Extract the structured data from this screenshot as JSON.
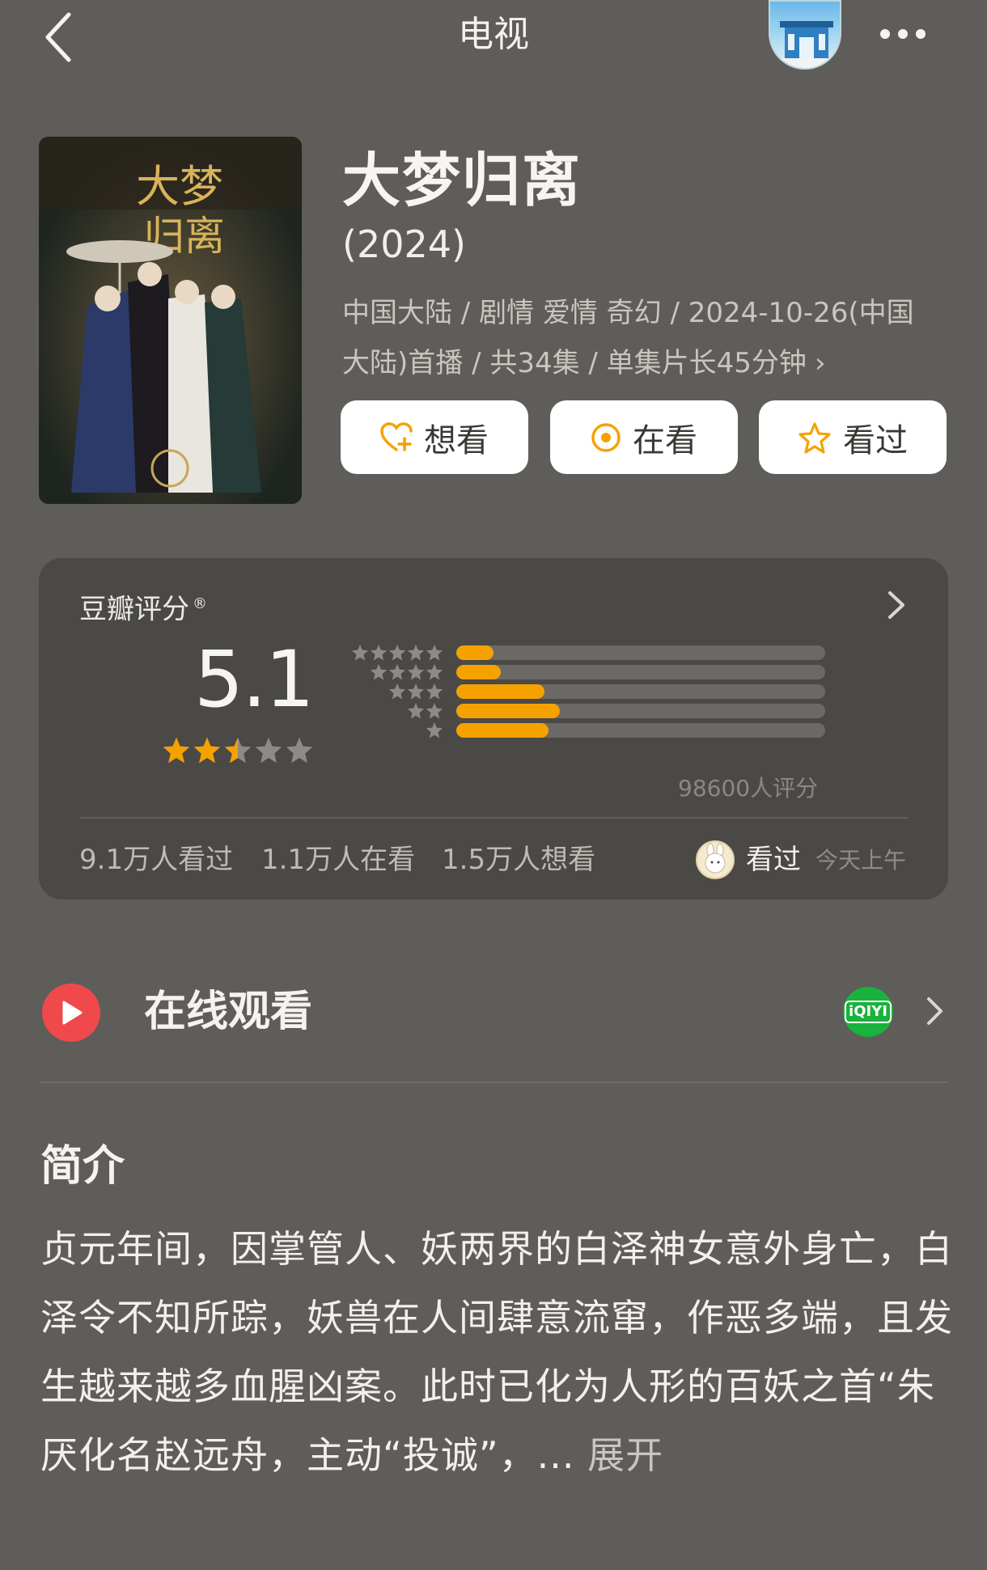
{
  "header": {
    "title": "电视"
  },
  "show": {
    "title": "大梦归离",
    "year": "(2024)",
    "meta_line1": "中国大陆 / 剧情 爱情 奇幻 / 2024-10-26(中国",
    "meta_line2": "大陆)首播 / 共34集 / 单集片长45分钟",
    "chevron": "›"
  },
  "actions": {
    "want_label": "想看",
    "watching_label": "在看",
    "watched_label": "看过"
  },
  "rating": {
    "label": "豆瓣评分",
    "registered": "®",
    "score": "5.1",
    "stars_value": 2.5,
    "distribution": [
      {
        "stars": 5,
        "fraction": 0.1
      },
      {
        "stars": 4,
        "fraction": 0.12
      },
      {
        "stars": 3,
        "fraction": 0.24
      },
      {
        "stars": 2,
        "fraction": 0.28
      },
      {
        "stars": 1,
        "fraction": 0.25
      }
    ],
    "count_text": "98600人评分",
    "stats": {
      "seen": "9.1万人看过",
      "watching": "1.1万人在看",
      "want": "1.5万人想看"
    },
    "user_status": "看过",
    "user_time": "今天上午"
  },
  "watch_online": {
    "label": "在线观看",
    "provider_logo_text": "iQIYI"
  },
  "synopsis": {
    "heading": "简介",
    "text": "贞元年间，因掌管人、妖两界的白泽神女意外身亡，白泽令不知所踪，妖兽在人间肆意流窜，作恶多端，且发生越来越多血腥凶案。此时已化为人形的百妖之首“朱厌化名赵远舟，主动“投诚”，... ",
    "expand": "展开"
  },
  "colors": {
    "background": "#5f5d59",
    "card": "#4b4946",
    "accent": "#f5a200",
    "play_red": "#f0494c",
    "iqiyi_green": "#19b23c"
  },
  "icons": {
    "back": "chevron-left-icon",
    "more": "more-horizontal-icon",
    "want": "heart-plus-icon",
    "watching": "target-circle-icon",
    "watched": "star-outline-icon",
    "play": "play-icon"
  }
}
